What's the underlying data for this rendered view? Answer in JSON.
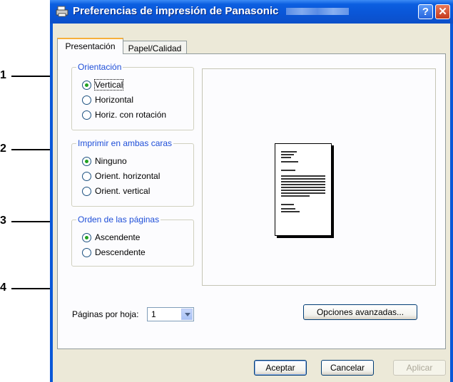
{
  "window": {
    "title": "Preferencias de impresión de Panasonic"
  },
  "tabs": [
    {
      "label": "Presentación",
      "active": true
    },
    {
      "label": "Papel/Calidad",
      "active": false
    }
  ],
  "callouts": [
    "1",
    "2",
    "3",
    "4"
  ],
  "orientation": {
    "legend": "Orientación",
    "options": [
      {
        "label": "Vertical",
        "selected": true
      },
      {
        "label": "Horizontal",
        "selected": false
      },
      {
        "label": "Horiz. con rotación",
        "selected": false
      }
    ]
  },
  "duplex": {
    "legend": "Imprimir en ambas caras",
    "options": [
      {
        "label": "Ninguno",
        "selected": true
      },
      {
        "label": "Orient. horizontal",
        "selected": false
      },
      {
        "label": "Orient. vertical",
        "selected": false
      }
    ]
  },
  "page_order": {
    "legend": "Orden de las páginas",
    "options": [
      {
        "label": "Ascendente",
        "selected": true
      },
      {
        "label": "Descendente",
        "selected": false
      }
    ]
  },
  "pages_per_sheet": {
    "label": "Páginas por hoja:",
    "value": "1"
  },
  "buttons": {
    "advanced": "Opciones avanzadas...",
    "ok": "Aceptar",
    "cancel": "Cancelar",
    "apply": "Aplicar"
  },
  "titlebar_buttons": {
    "help": "?",
    "close": "✕"
  },
  "colors": {
    "titlebar": "#0a55d6",
    "legend_text": "#1f4fd8",
    "radio_dot": "#21a121",
    "dialog_bg": "#ece9d8"
  }
}
